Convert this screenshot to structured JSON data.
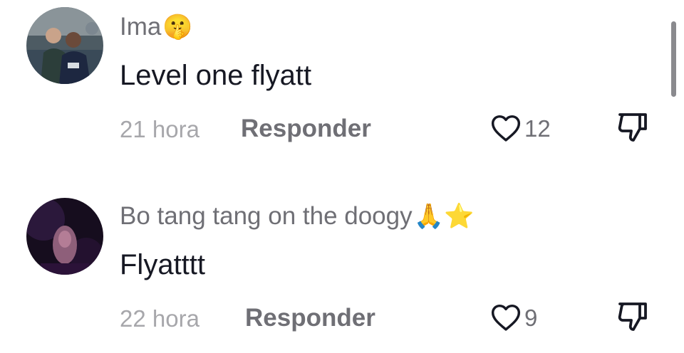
{
  "comments": [
    {
      "username": "Ima",
      "username_emoji": "🤫",
      "text": "Level one flyatt",
      "time": "21 hora",
      "reply_label": "Responder",
      "like_count": "12"
    },
    {
      "username": "Bo tang tang on the doogy",
      "username_emoji": "🙏⭐️",
      "text": "Flyatttt",
      "time": "22 hora",
      "reply_label": "Responder",
      "like_count": "9"
    }
  ],
  "icons": {
    "like": "heart-outline-icon",
    "dislike": "thumbs-down-outline-icon"
  },
  "colors": {
    "username": "#6f6f75",
    "text": "#161823",
    "meta": "#a7a7ab"
  }
}
